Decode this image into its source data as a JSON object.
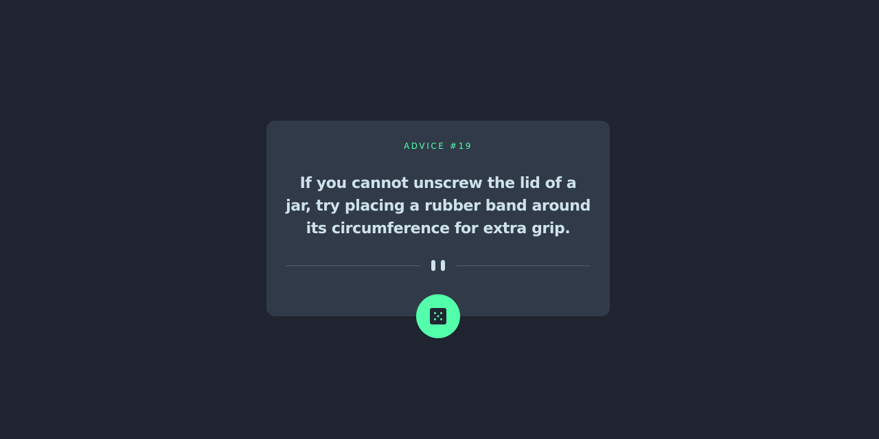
{
  "advice": {
    "label": "ADVICE #19",
    "quote": "If you cannot unscrew the lid of a jar, try placing a rubber band around its circumference for extra grip."
  },
  "divider": {
    "icon": "pause-icon"
  },
  "generate_button": {
    "icon": "dice-icon"
  },
  "colors": {
    "background": "#1f2430",
    "card": "#313a49",
    "accent": "#53ffaa",
    "text": "#cee3e9",
    "divider": "#4f5d74"
  }
}
